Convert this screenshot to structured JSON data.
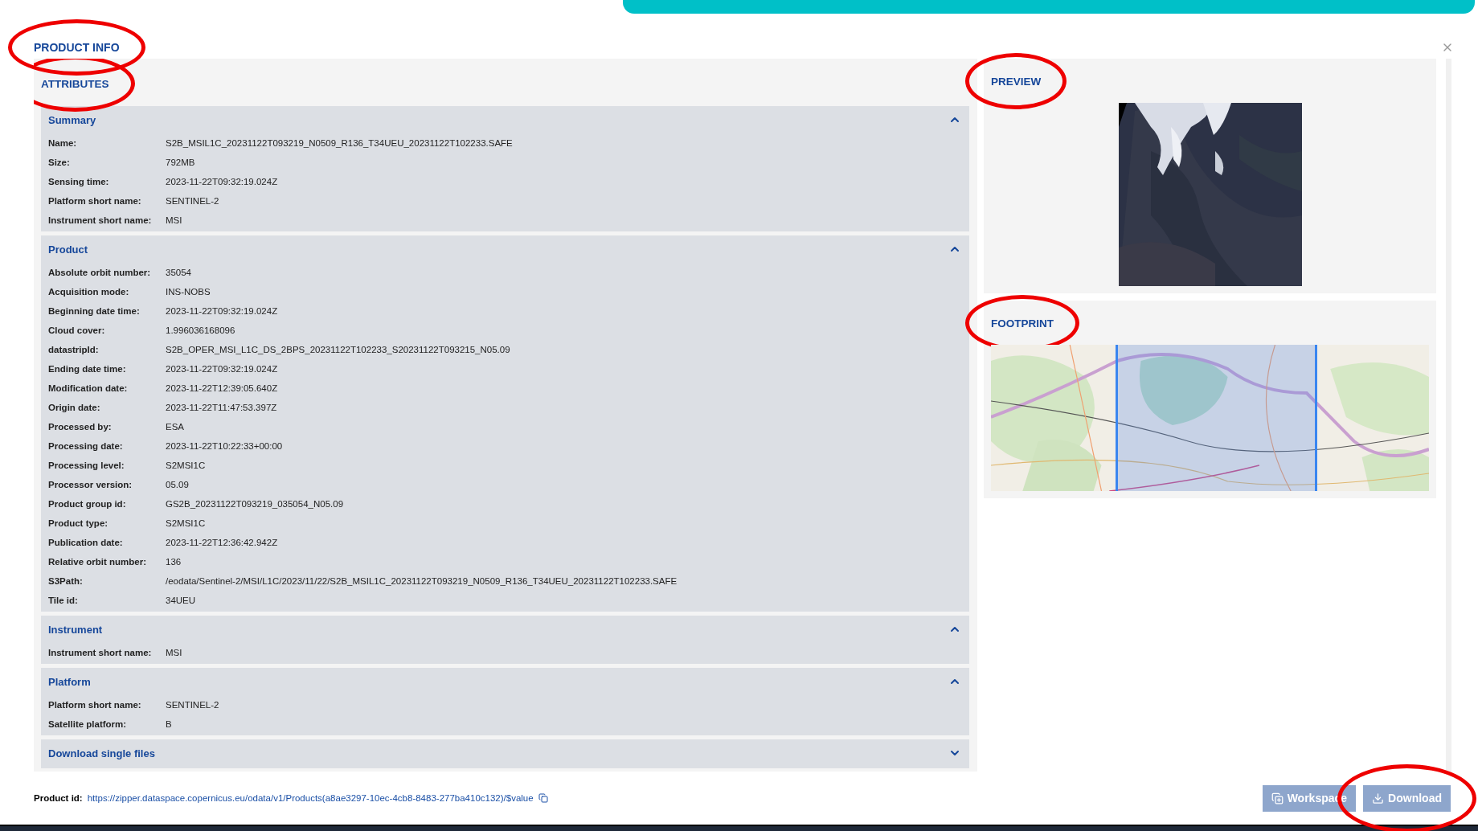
{
  "title": {
    "text": "PRODUCT INFO",
    "circled": true
  },
  "attributes": {
    "heading": "ATTRIBUTES",
    "circled": true,
    "sections": [
      {
        "title": "Summary",
        "expanded": true,
        "rows": [
          {
            "label": "Name:",
            "value": "S2B_MSIL1C_20231122T093219_N0509_R136_T34UEU_20231122T102233.SAFE"
          },
          {
            "label": "Size:",
            "value": "792MB"
          },
          {
            "label": "Sensing time:",
            "value": "2023-11-22T09:32:19.024Z"
          },
          {
            "label": "Platform short name:",
            "value": "SENTINEL-2"
          },
          {
            "label": "Instrument short name:",
            "value": "MSI"
          }
        ]
      },
      {
        "title": "Product",
        "expanded": true,
        "rows": [
          {
            "label": "Absolute orbit number:",
            "value": "35054"
          },
          {
            "label": "Acquisition mode:",
            "value": "INS-NOBS"
          },
          {
            "label": "Beginning date time:",
            "value": "2023-11-22T09:32:19.024Z"
          },
          {
            "label": "Cloud cover:",
            "value": "1.996036168096"
          },
          {
            "label": "datastripId:",
            "value": "S2B_OPER_MSI_L1C_DS_2BPS_20231122T102233_S20231122T093215_N05.09"
          },
          {
            "label": "Ending date time:",
            "value": "2023-11-22T09:32:19.024Z"
          },
          {
            "label": "Modification date:",
            "value": "2023-11-22T12:39:05.640Z"
          },
          {
            "label": "Origin date:",
            "value": "2023-11-22T11:47:53.397Z"
          },
          {
            "label": "Processed by:",
            "value": "ESA"
          },
          {
            "label": "Processing date:",
            "value": "2023-11-22T10:22:33+00:00"
          },
          {
            "label": "Processing level:",
            "value": "S2MSI1C"
          },
          {
            "label": "Processor version:",
            "value": "05.09"
          },
          {
            "label": "Product group id:",
            "value": "GS2B_20231122T093219_035054_N05.09"
          },
          {
            "label": "Product type:",
            "value": "S2MSI1C"
          },
          {
            "label": "Publication date:",
            "value": "2023-11-22T12:36:42.942Z"
          },
          {
            "label": "Relative orbit number:",
            "value": "136"
          },
          {
            "label": "S3Path:",
            "value": "/eodata/Sentinel-2/MSI/L1C/2023/11/22/S2B_MSIL1C_20231122T093219_N0509_R136_T34UEU_20231122T102233.SAFE"
          },
          {
            "label": "Tile id:",
            "value": "34UEU"
          }
        ]
      },
      {
        "title": "Instrument",
        "expanded": true,
        "rows": [
          {
            "label": "Instrument short name:",
            "value": "MSI"
          }
        ]
      },
      {
        "title": "Platform",
        "expanded": true,
        "rows": [
          {
            "label": "Platform short name:",
            "value": "SENTINEL-2"
          },
          {
            "label": "Satellite platform:",
            "value": "B"
          }
        ]
      },
      {
        "title": "Download single files",
        "expanded": false
      }
    ]
  },
  "preview": {
    "heading": "PREVIEW",
    "circled": true
  },
  "footprint": {
    "heading": "FOOTPRINT",
    "circled": true
  },
  "footer": {
    "label": "Product id:",
    "link": "https://zipper.dataspace.copernicus.eu/odata/v1/Products(a8ae3297-10ec-4cb8-8483-277ba410c132)/$value"
  },
  "buttons": [
    {
      "kind": "workspace",
      "label": "Workspace",
      "disabled": true,
      "circled": false
    },
    {
      "kind": "download",
      "label": "Download",
      "disabled": true,
      "circled": true
    }
  ]
}
